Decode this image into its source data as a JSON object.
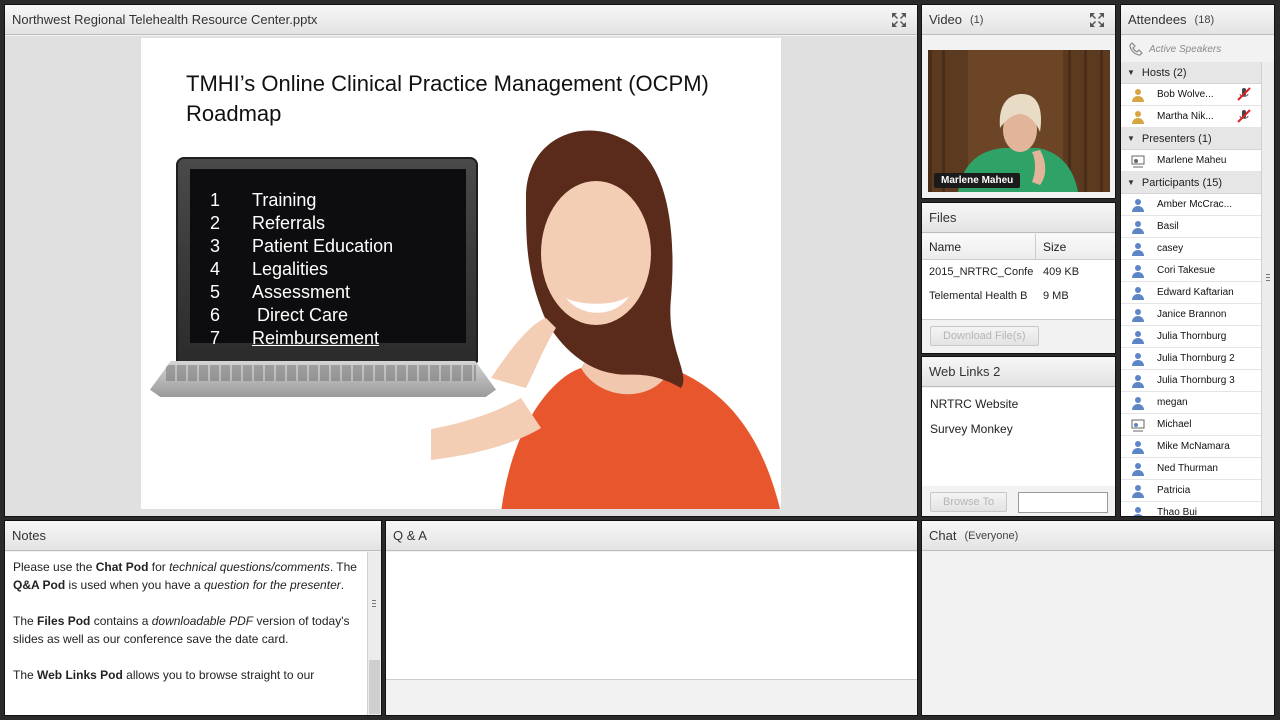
{
  "share": {
    "title": "Northwest Regional Telehealth Resource Center.pptx",
    "slide_title": "TMHI’s Online Clinical Practice Management (OCPM) Roadmap",
    "roadmap": [
      {
        "num": "1",
        "label": "Training"
      },
      {
        "num": "2",
        "label": "Referrals"
      },
      {
        "num": "3",
        "label": "Patient Education"
      },
      {
        "num": "4",
        "label": "Legalities"
      },
      {
        "num": "5",
        "label": "Assessment"
      },
      {
        "num": "6",
        "label": " Direct Care"
      },
      {
        "num": "7",
        "label": "Reimbursement"
      }
    ]
  },
  "video": {
    "title": "Video",
    "count": "(1)",
    "speaker_name": "Marlene Maheu"
  },
  "files": {
    "title": "Files",
    "col_name": "Name",
    "col_size": "Size",
    "rows": [
      {
        "name": "2015_NRTRC_Confe",
        "size": "409 KB"
      },
      {
        "name": "Telemental Health B",
        "size": "9 MB"
      }
    ],
    "download_label": "Download File(s)"
  },
  "web_links": {
    "title": "Web Links 2",
    "items": [
      "NRTRC Website",
      "Survey Monkey"
    ],
    "browse_label": "Browse To"
  },
  "attendees": {
    "title": "Attendees",
    "count": "(18)",
    "active_speakers": "Active Speakers",
    "hosts_label": "Hosts (2)",
    "hosts": [
      "Bob Wolve...",
      "Martha Nik..."
    ],
    "presenters_label": "Presenters (1)",
    "presenters": [
      "Marlene Maheu"
    ],
    "participants_label": "Participants (15)",
    "participants": [
      "Amber McCrac...",
      "Basil",
      "casey",
      "Cori Takesue",
      "Edward Kaftarian",
      "Janice Brannon",
      "Julia Thornburg",
      "Julia Thornburg 2",
      "Julia Thornburg 3",
      "megan",
      "Michael",
      "Mike McNamara",
      "Ned Thurman",
      "Patricia",
      "Thao Bui"
    ]
  },
  "notes": {
    "title": "Notes",
    "p1_a": "Please use the ",
    "p1_b": "Chat Pod",
    "p1_c": " for ",
    "p1_d": "technical questions/comments",
    "p1_e": ". The ",
    "p1_f": "Q&A Pod",
    "p1_g": " is used when you have a ",
    "p1_h": "question for the presenter",
    "p1_i": ".",
    "p2_a": "The ",
    "p2_b": "Files Pod",
    "p2_c": " contains a ",
    "p2_d": "downloadable PDF",
    "p2_e": " version of today's slides as well as our conference save the date card.",
    "p3_a": "The ",
    "p3_b": "Web Links Pod",
    "p3_c": " allows you to browse straight to our"
  },
  "qa": {
    "title": "Q & A"
  },
  "chat": {
    "title": "Chat",
    "audience": "(Everyone)"
  }
}
